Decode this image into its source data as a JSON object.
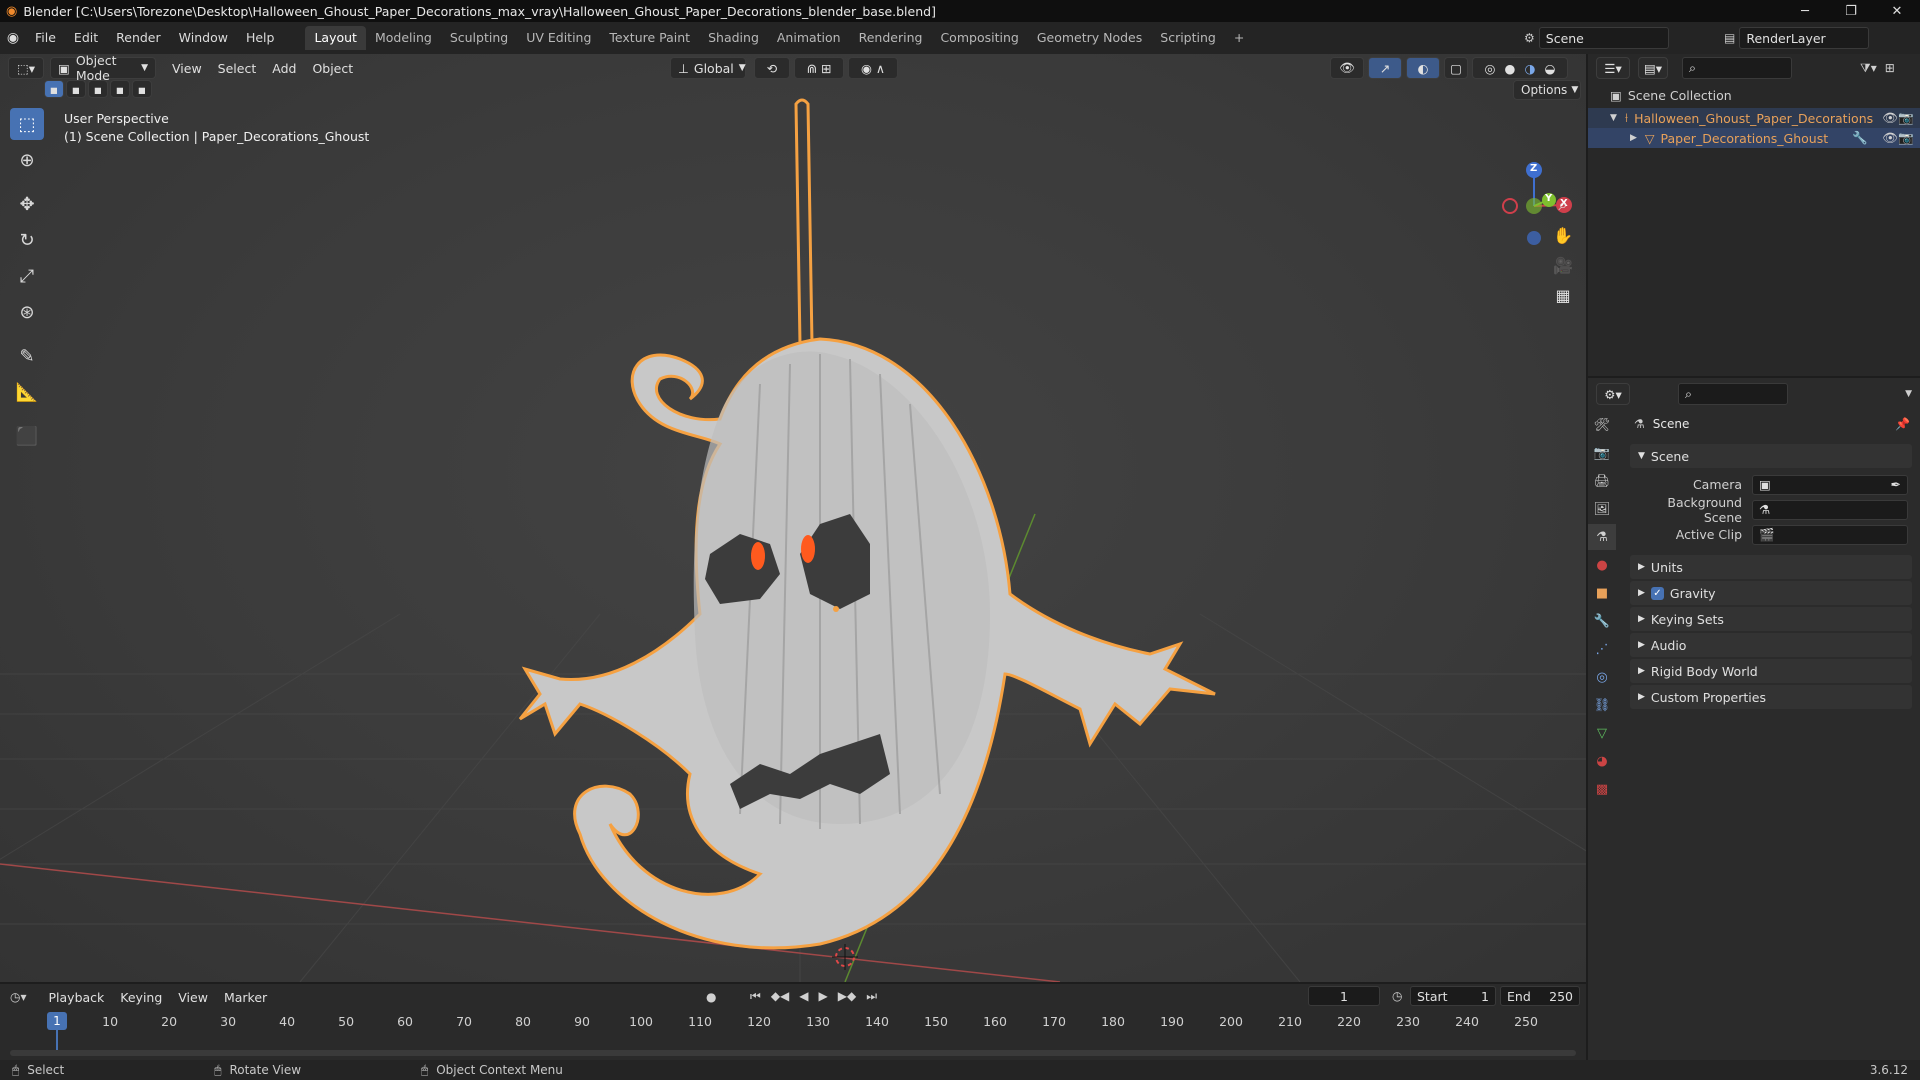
{
  "window": {
    "title": "Blender [C:\\Users\\Torezone\\Desktop\\Halloween_Ghoust_Paper_Decorations_max_vray\\Halloween_Ghoust_Paper_Decorations_blender_base.blend]",
    "minimize": "─",
    "maximize": "❐",
    "close": "✕"
  },
  "menu": [
    "File",
    "Edit",
    "Render",
    "Window",
    "Help"
  ],
  "workspaces": {
    "active": "Layout",
    "tabs": [
      "Layout",
      "Modeling",
      "Sculpting",
      "UV Editing",
      "Texture Paint",
      "Shading",
      "Animation",
      "Rendering",
      "Compositing",
      "Geometry Nodes",
      "Scripting"
    ],
    "add": "+"
  },
  "scene_selector": {
    "value": "Scene"
  },
  "view_layer_selector": {
    "value": "RenderLayer"
  },
  "viewport": {
    "mode": "Object Mode",
    "menu": [
      "View",
      "Select",
      "Add",
      "Object"
    ],
    "transform_orientation": "Global",
    "options": "Options",
    "overlay_line1": "User Perspective",
    "overlay_line2": "(1) Scene Collection | Paper_Decorations_Ghoust",
    "gizmo": {
      "x": "X",
      "y": "Y",
      "z": "Z"
    }
  },
  "outliner": {
    "root": "Scene Collection",
    "items": [
      {
        "label": "Halloween_Ghoust_Paper_Decorations",
        "color": "#e8a15a"
      },
      {
        "label": "Paper_Decorations_Ghoust",
        "color": "#e8a15a"
      }
    ]
  },
  "properties": {
    "context": "Scene",
    "section_scene": "Scene",
    "fields": [
      {
        "label": "Camera",
        "value": ""
      },
      {
        "label": "Background Scene",
        "value": ""
      },
      {
        "label": "Active Clip",
        "value": ""
      }
    ],
    "sections": [
      {
        "label": "Units",
        "checkbox": false
      },
      {
        "label": "Gravity",
        "checkbox": true
      },
      {
        "label": "Keying Sets",
        "checkbox": false
      },
      {
        "label": "Audio",
        "checkbox": false
      },
      {
        "label": "Rigid Body World",
        "checkbox": false
      },
      {
        "label": "Custom Properties",
        "checkbox": false
      }
    ]
  },
  "timeline": {
    "menu": [
      "Playback",
      "Keying",
      "View",
      "Marker"
    ],
    "current_frame": "1",
    "start_label": "Start",
    "start": "1",
    "end_label": "End",
    "end": "250",
    "ticks": [
      "1",
      "10",
      "20",
      "30",
      "40",
      "50",
      "60",
      "70",
      "80",
      "90",
      "100",
      "110",
      "120",
      "130",
      "140",
      "150",
      "160",
      "170",
      "180",
      "190",
      "200",
      "210",
      "220",
      "230",
      "240",
      "250"
    ],
    "frame_range": {
      "start": 1,
      "end": 250,
      "current": 1
    }
  },
  "status": {
    "select": "Select",
    "rotate": "Rotate View",
    "context_menu": "Object Context Menu",
    "version": "3.6.12"
  },
  "colors": {
    "accent": "#4772b3",
    "selection_outline": "#f5a142",
    "active_object": "#e8a15a"
  }
}
